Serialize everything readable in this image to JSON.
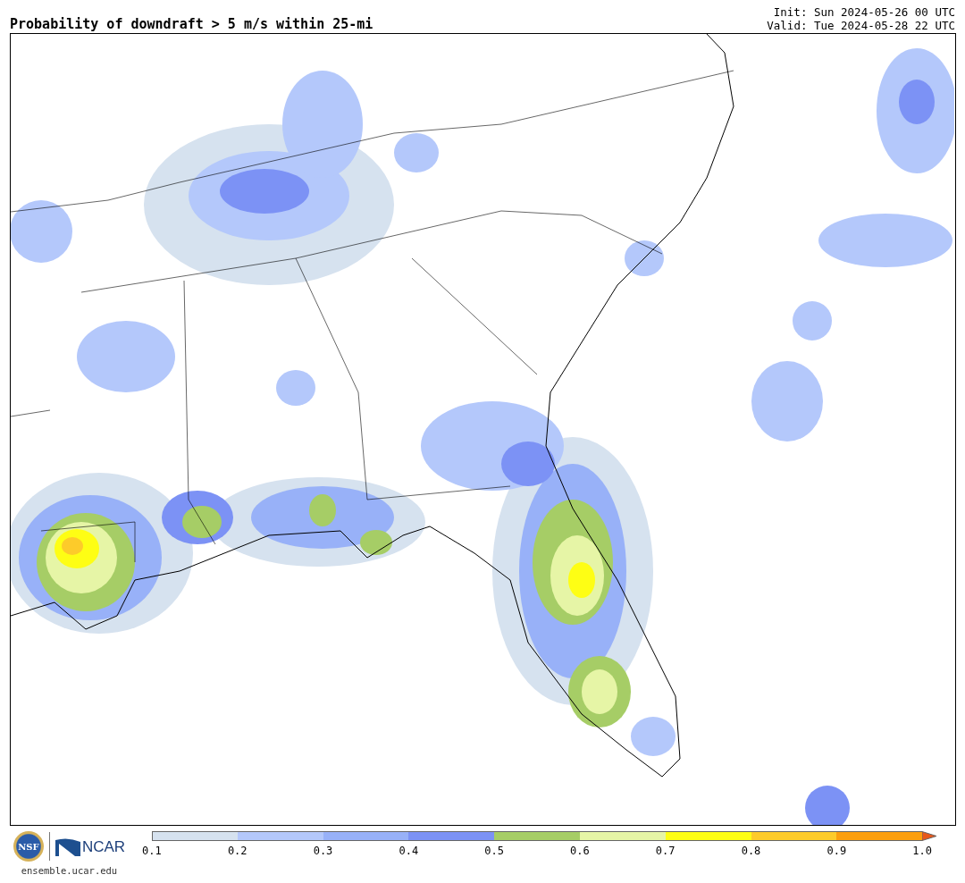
{
  "title": "Probability of downdraft > 5 m/s within 25-mi",
  "init": "Init: Sun 2024-05-26 00 UTC",
  "valid": "Valid: Tue 2024-05-28 22 UTC",
  "logos": {
    "nsf": "NSF",
    "ncar": "NCAR",
    "site": "ensemble.ucar.edu"
  },
  "colorbar": {
    "segments": [
      {
        "color": "#d6e2ef"
      },
      {
        "color": "#b4c8fb"
      },
      {
        "color": "#98b1f8"
      },
      {
        "color": "#7c92f5"
      },
      {
        "color": "#a6cd66"
      },
      {
        "color": "#e6f5a6"
      },
      {
        "color": "#fefe14"
      },
      {
        "color": "#fdcb2a"
      },
      {
        "color": "#fc9f0e"
      },
      {
        "color": "#e8581a",
        "kind": "arrow"
      }
    ],
    "labels": [
      "0.1",
      "0.2",
      "0.3",
      "0.4",
      "0.5",
      "0.6",
      "0.7",
      "0.8",
      "0.9",
      "1.0"
    ]
  }
}
